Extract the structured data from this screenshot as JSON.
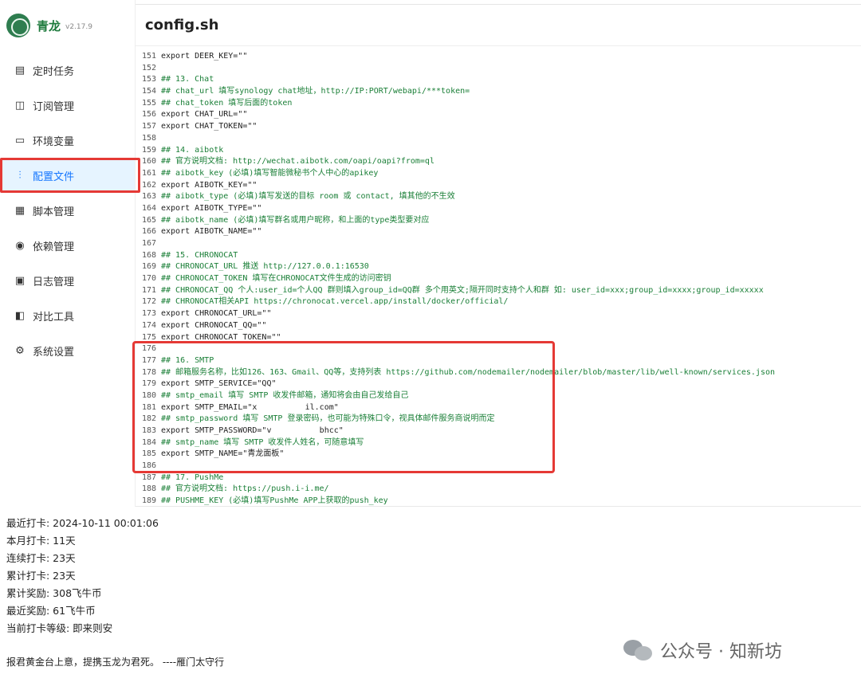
{
  "app": {
    "name": "青龙",
    "version": "v2.17.9"
  },
  "sidebar": {
    "items": [
      {
        "label": "定时任务",
        "icon": "calendar-icon"
      },
      {
        "label": "订阅管理",
        "icon": "subscribe-icon"
      },
      {
        "label": "环境变量",
        "icon": "monitor-icon"
      },
      {
        "label": "配置文件",
        "icon": "sliders-icon",
        "active": true
      },
      {
        "label": "脚本管理",
        "icon": "script-icon"
      },
      {
        "label": "依赖管理",
        "icon": "dependency-icon"
      },
      {
        "label": "日志管理",
        "icon": "log-icon"
      },
      {
        "label": "对比工具",
        "icon": "diff-icon"
      },
      {
        "label": "系统设置",
        "icon": "gear-icon"
      }
    ]
  },
  "page": {
    "title": "config.sh"
  },
  "code": [
    {
      "n": "151",
      "t": "export DEER_KEY=\"\""
    },
    {
      "n": "152",
      "t": ""
    },
    {
      "n": "153",
      "t": "## 13. Chat"
    },
    {
      "n": "154",
      "t": "## chat_url 填写synology chat地址，http://IP:PORT/webapi/***token="
    },
    {
      "n": "155",
      "t": "## chat_token 填写后面的token"
    },
    {
      "n": "156",
      "t": "export CHAT_URL=\"\""
    },
    {
      "n": "157",
      "t": "export CHAT_TOKEN=\"\""
    },
    {
      "n": "158",
      "t": ""
    },
    {
      "n": "159",
      "t": "## 14. aibotk"
    },
    {
      "n": "160",
      "t": "## 官方说明文档: http://wechat.aibotk.com/oapi/oapi?from=ql"
    },
    {
      "n": "161",
      "t": "## aibotk_key (必填)填写智能微秘书个人中心的apikey"
    },
    {
      "n": "162",
      "t": "export AIBOTK_KEY=\"\""
    },
    {
      "n": "163",
      "t": "## aibotk_type (必填)填写发送的目标 room 或 contact, 填其他的不生效"
    },
    {
      "n": "164",
      "t": "export AIBOTK_TYPE=\"\""
    },
    {
      "n": "165",
      "t": "## aibotk_name (必填)填写群名或用户昵称，和上面的type类型要对应"
    },
    {
      "n": "166",
      "t": "export AIBOTK_NAME=\"\""
    },
    {
      "n": "167",
      "t": ""
    },
    {
      "n": "168",
      "t": "## 15. CHRONOCAT"
    },
    {
      "n": "169",
      "t": "## CHRONOCAT_URL 推送 http://127.0.0.1:16530"
    },
    {
      "n": "170",
      "t": "## CHRONOCAT_TOKEN 填写在CHRONOCAT文件生成的访问密钥"
    },
    {
      "n": "171",
      "t": "## CHRONOCAT_QQ 个人:user_id=个人QQ 群则填入group_id=QQ群 多个用英文;隔开同时支持个人和群 如: user_id=xxx;group_id=xxxx;group_id=xxxxx"
    },
    {
      "n": "172",
      "t": "## CHRONOCAT相关API https://chronocat.vercel.app/install/docker/official/"
    },
    {
      "n": "173",
      "t": "export CHRONOCAT_URL=\"\""
    },
    {
      "n": "174",
      "t": "export CHRONOCAT_QQ=\"\""
    },
    {
      "n": "175",
      "t": "export CHRONOCAT_TOKEN=\"\""
    },
    {
      "n": "176",
      "t": ""
    },
    {
      "n": "177",
      "t": "## 16. SMTP"
    },
    {
      "n": "178",
      "t": "## 邮箱服务名称，比如126、163、Gmail、QQ等，支持列表 https://github.com/nodemailer/nodemailer/blob/master/lib/well-known/services.json"
    },
    {
      "n": "179",
      "t": "export SMTP_SERVICE=\"QQ\""
    },
    {
      "n": "180",
      "t": "## smtp_email 填写 SMTP 收发件邮箱，通知将会由自己发给自己"
    },
    {
      "n": "181",
      "t": "export SMTP_EMAIL=\"x          il.com\""
    },
    {
      "n": "182",
      "t": "## smtp_password 填写 SMTP 登录密码，也可能为特殊口令，视具体邮件服务商说明而定"
    },
    {
      "n": "183",
      "t": "export SMTP_PASSWORD=\"v          bhcc\""
    },
    {
      "n": "184",
      "t": "## smtp_name 填写 SMTP 收发件人姓名，可随意填写"
    },
    {
      "n": "185",
      "t": "export SMTP_NAME=\"青龙面板\""
    },
    {
      "n": "186",
      "t": ""
    },
    {
      "n": "187",
      "t": "## 17. PushMe"
    },
    {
      "n": "188",
      "t": "## 官方说明文档: https://push.i-i.me/"
    },
    {
      "n": "189",
      "t": "## PUSHME_KEY (必填)填写PushMe APP上获取的push_key"
    }
  ],
  "stats": [
    "最近打卡: 2024-10-11 00:01:06",
    "本月打卡: 11天",
    "连续打卡: 23天",
    "累计打卡: 23天",
    "累计奖励: 308飞牛币",
    "最近奖励: 61飞牛币",
    "当前打卡等级: 即来则安"
  ],
  "poem": "报君黄金台上意，提携玉龙为君死。 ----雁门太守行",
  "watermark": "公众号 · 知新坊",
  "colors": {
    "accent": "#1677ff",
    "highlight": "#e53935",
    "comment": "#1a7f37",
    "brand": "#1d7a3c"
  }
}
